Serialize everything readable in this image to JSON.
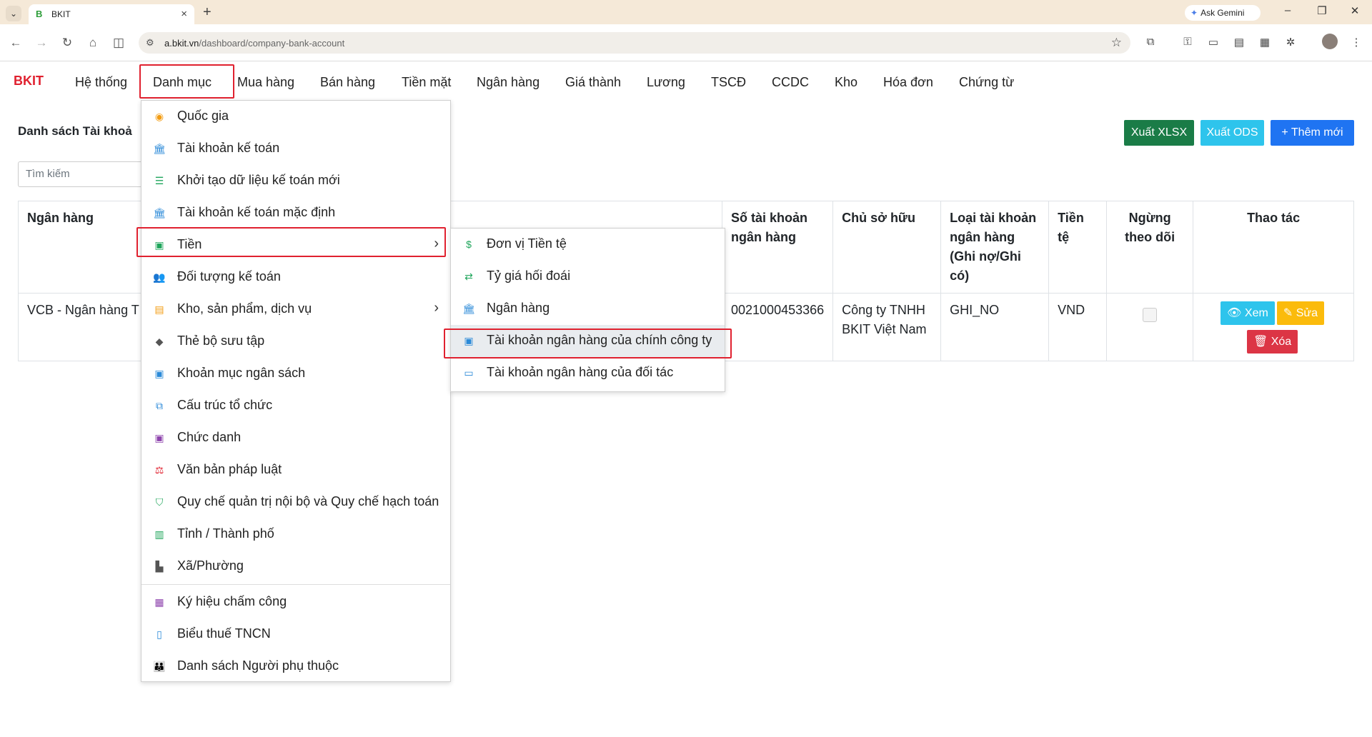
{
  "browser": {
    "tab_title": "BKIT",
    "favicon_letter": "B",
    "ask_gemini": "Ask Gemini",
    "url_host": "a.bkit.vn",
    "url_path": "/dashboard/company-bank-account"
  },
  "app": {
    "brand": "BKIT",
    "nav": [
      "Hệ thống",
      "Danh mục",
      "Mua hàng",
      "Bán hàng",
      "Tiền mặt",
      "Ngân hàng",
      "Giá thành",
      "Lương",
      "TSCĐ",
      "CCDC",
      "Kho",
      "Hóa đơn",
      "Chứng từ"
    ]
  },
  "page": {
    "title": "Danh sách Tài khoả",
    "search_placeholder": "Tìm kiếm",
    "btn_xlsx": "Xuất XLSX",
    "btn_ods": "Xuất ODS",
    "btn_add": "+ Thêm mới"
  },
  "table": {
    "headers": {
      "bank": "Ngân hàng",
      "account_no": "Số tài khoản ngân hàng",
      "owner": "Chủ sở hữu",
      "type": "Loại tài khoản ngân hàng (Ghi nợ/Ghi có)",
      "currency": "Tiền tệ",
      "stop": "Ngừng theo dõi",
      "actions": "Thao tác"
    },
    "row": {
      "bank": "VCB - Ngân hàng T",
      "account_no": "0021000453366",
      "owner": "Công ty TNHH BKIT Việt Nam",
      "type": "GHI_NO",
      "currency": "VND"
    },
    "actions": {
      "view": "Xem",
      "edit": "Sửa",
      "delete": "Xóa"
    }
  },
  "menu": {
    "items": [
      "Quốc gia",
      "Tài khoản kế toán",
      "Khởi tạo dữ liệu kế toán mới",
      "Tài khoản kế toán mặc định",
      "Tiền",
      "Đối tượng kế toán",
      "Kho, sản phẩm, dịch vụ",
      "Thẻ bộ sưu tập",
      "Khoản mục ngân sách",
      "Cấu trúc tổ chức",
      "Chức danh",
      "Văn bản pháp luật",
      "Quy chế quản trị nội bộ và Quy chế hạch toán",
      "Tỉnh / Thành phố",
      "Xã/Phường",
      "Ký hiệu chấm công",
      "Biểu thuế TNCN",
      "Danh sách Người phụ thuộc"
    ],
    "submenu": [
      "Đơn vị Tiền tệ",
      "Tỷ giá hối đoái",
      "Ngân hàng",
      "Tài khoản ngân hàng của chính công ty",
      "Tài khoản ngân hàng của đối tác"
    ]
  },
  "colors": {
    "brand_red": "#e0212f",
    "btn_green": "#1a7c47",
    "btn_cyan": "#2ec4ec",
    "btn_blue": "#1f74f2"
  }
}
